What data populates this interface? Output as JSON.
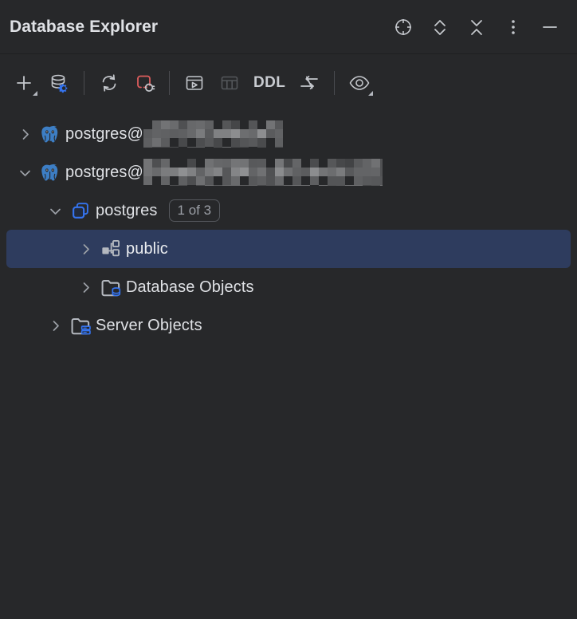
{
  "header": {
    "title": "Database Explorer",
    "actions": [
      {
        "name": "locate-target-icon",
        "tooltip": "Select Opened File"
      },
      {
        "name": "expand-collapse-icon",
        "tooltip": "Expand / Collapse"
      },
      {
        "name": "collapse-all-icon",
        "tooltip": "Collapse All"
      },
      {
        "name": "more-options-icon",
        "tooltip": "Options"
      },
      {
        "name": "minimize-icon",
        "tooltip": "Hide"
      }
    ]
  },
  "toolbar": {
    "items": [
      {
        "name": "add-new-button",
        "icon": "plus-icon",
        "label": "",
        "dropdown": true,
        "disabled": false
      },
      {
        "name": "data-source-properties-button",
        "icon": "database-settings-icon",
        "label": "",
        "dropdown": false,
        "disabled": false
      },
      {
        "name": "separator-1",
        "icon": "separator",
        "label": "",
        "dropdown": false,
        "disabled": false
      },
      {
        "name": "refresh-button",
        "icon": "refresh-icon",
        "label": "",
        "dropdown": false,
        "disabled": false
      },
      {
        "name": "disconnect-button",
        "icon": "disconnect-icon",
        "label": "",
        "dropdown": false,
        "disabled": false
      },
      {
        "name": "separator-2",
        "icon": "separator",
        "label": "",
        "dropdown": false,
        "disabled": false
      },
      {
        "name": "open-console-button",
        "icon": "console-icon",
        "label": "",
        "dropdown": false,
        "disabled": false
      },
      {
        "name": "open-data-editor-button",
        "icon": "table-grid-icon",
        "label": "",
        "dropdown": false,
        "disabled": true
      },
      {
        "name": "ddl-button",
        "icon": "text-label",
        "label": "DDL",
        "dropdown": false,
        "disabled": false
      },
      {
        "name": "data-transfer-button",
        "icon": "transfer-icon",
        "label": "",
        "dropdown": false,
        "disabled": false
      },
      {
        "name": "separator-3",
        "icon": "separator",
        "label": "",
        "dropdown": false,
        "disabled": false
      },
      {
        "name": "view-options-button",
        "icon": "eye-icon",
        "label": "",
        "dropdown": true,
        "disabled": false
      }
    ]
  },
  "tree": {
    "nodes": [
      {
        "name": "tree-row-datasource-1",
        "label": "postgres@",
        "icon": "postgresql-elephant-icon",
        "twisty": "collapsed",
        "depth": 0,
        "selected": false,
        "redacted": true,
        "redacted_width": 175,
        "badge": ""
      },
      {
        "name": "tree-row-datasource-2",
        "label": "postgres@",
        "icon": "postgresql-elephant-icon",
        "twisty": "expanded",
        "depth": 0,
        "selected": false,
        "redacted": true,
        "redacted_width": 300,
        "badge": ""
      },
      {
        "name": "tree-row-database-postgres",
        "label": "postgres",
        "icon": "database-stack-icon",
        "twisty": "expanded",
        "depth": 1,
        "selected": false,
        "redacted": false,
        "redacted_width": 0,
        "badge": "1 of 3"
      },
      {
        "name": "tree-row-schema-public",
        "label": "public",
        "icon": "schema-nodes-icon",
        "twisty": "collapsed",
        "depth": 2,
        "selected": true,
        "redacted": false,
        "redacted_width": 0,
        "badge": ""
      },
      {
        "name": "tree-row-database-objects",
        "label": "Database Objects",
        "icon": "folder-database-icon",
        "twisty": "collapsed",
        "depth": 2,
        "selected": false,
        "redacted": false,
        "redacted_width": 0,
        "badge": ""
      },
      {
        "name": "tree-row-server-objects",
        "label": "Server Objects",
        "icon": "folder-server-icon",
        "twisty": "collapsed",
        "depth": 1,
        "selected": false,
        "redacted": false,
        "redacted_width": 0,
        "badge": ""
      }
    ]
  },
  "colors": {
    "background": "#27282a",
    "selection": "#2e3c5e",
    "accent_blue": "#3d7ec4",
    "accent_bright_blue": "#3574f0",
    "text": "#dfe1e5",
    "icon": "#b4b8bf",
    "icon_disabled": "#5c5f63",
    "danger_red": "#db5c5c",
    "separator": "#4a4c50"
  }
}
